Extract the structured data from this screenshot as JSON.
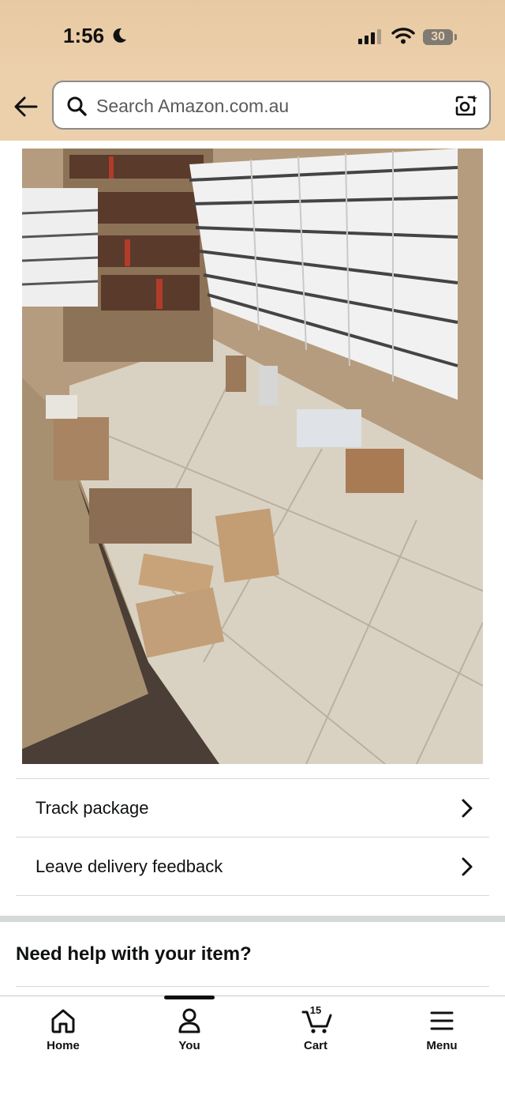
{
  "status": {
    "time": "1:56",
    "battery": "30"
  },
  "search": {
    "placeholder": "Search Amazon.com.au"
  },
  "image": {
    "alt": "Photo of packages left on the floor of a mailbox lobby"
  },
  "actions": [
    {
      "label": "Track package"
    },
    {
      "label": "Leave delivery feedback"
    }
  ],
  "help": {
    "title": "Need help with your item?"
  },
  "tabs": [
    {
      "label": "Home",
      "icon": "home-icon"
    },
    {
      "label": "You",
      "icon": "user-icon"
    },
    {
      "label": "Cart",
      "icon": "cart-icon",
      "count": "15"
    },
    {
      "label": "Menu",
      "icon": "menu-icon"
    }
  ],
  "colors": {
    "header": "#ecd0ac",
    "text": "#0f1111",
    "divider": "#d5d9d9"
  }
}
